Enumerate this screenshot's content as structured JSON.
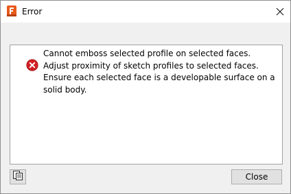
{
  "window": {
    "title": "Error",
    "app_icon": "fusion-app-icon",
    "close_icon": "close-icon"
  },
  "message": {
    "icon": "error-icon",
    "text": "Cannot emboss selected profile on selected faces. Adjust proximity of sketch profiles to selected faces. Ensure each selected face is a developable surface on a solid body."
  },
  "buttons": {
    "copy_icon": "copy-icon",
    "close_label": "Close"
  },
  "colors": {
    "brand_orange": "#e8591a",
    "error_red": "#d21f24"
  }
}
